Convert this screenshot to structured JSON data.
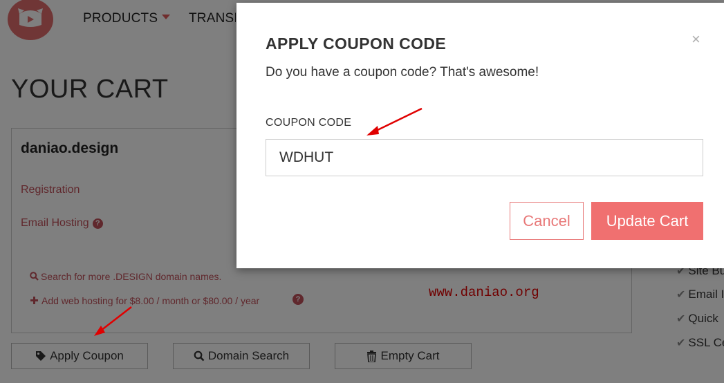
{
  "header": {
    "nav": [
      {
        "label": "PRODUCTS"
      },
      {
        "label": "TRANSFER"
      }
    ]
  },
  "cart": {
    "title": "YOUR CART",
    "domain": "daniao.design",
    "links": {
      "registration": "Registration",
      "email_hosting": "Email Hosting",
      "search_more": "Search for more .DESIGN domain names.",
      "add_hosting": "Add web hosting for $8.00 / month or $80.00 / year"
    },
    "buttons": {
      "apply_coupon": "Apply Coupon",
      "domain_search": "Domain Search",
      "empty_cart": "Empty Cart"
    }
  },
  "features": [
    "Site Bu",
    "Email I",
    "Quick",
    "SSL Ce"
  ],
  "watermark": "www.daniao.org",
  "modal": {
    "title": "APPLY COUPON CODE",
    "subtitle": "Do you have a coupon code? That's awesome!",
    "close": "×",
    "field_label": "COUPON CODE",
    "coupon_value": "WDHUT",
    "cancel": "Cancel",
    "update": "Update Cart"
  },
  "colors": {
    "brand": "#e16c6c",
    "link": "#c0505a",
    "primary_button": "#f07070",
    "annotation": "#e00000"
  },
  "icons": [
    "logo-icon",
    "tag-icon",
    "search-icon",
    "trash-icon",
    "check-icon",
    "help-icon"
  ]
}
